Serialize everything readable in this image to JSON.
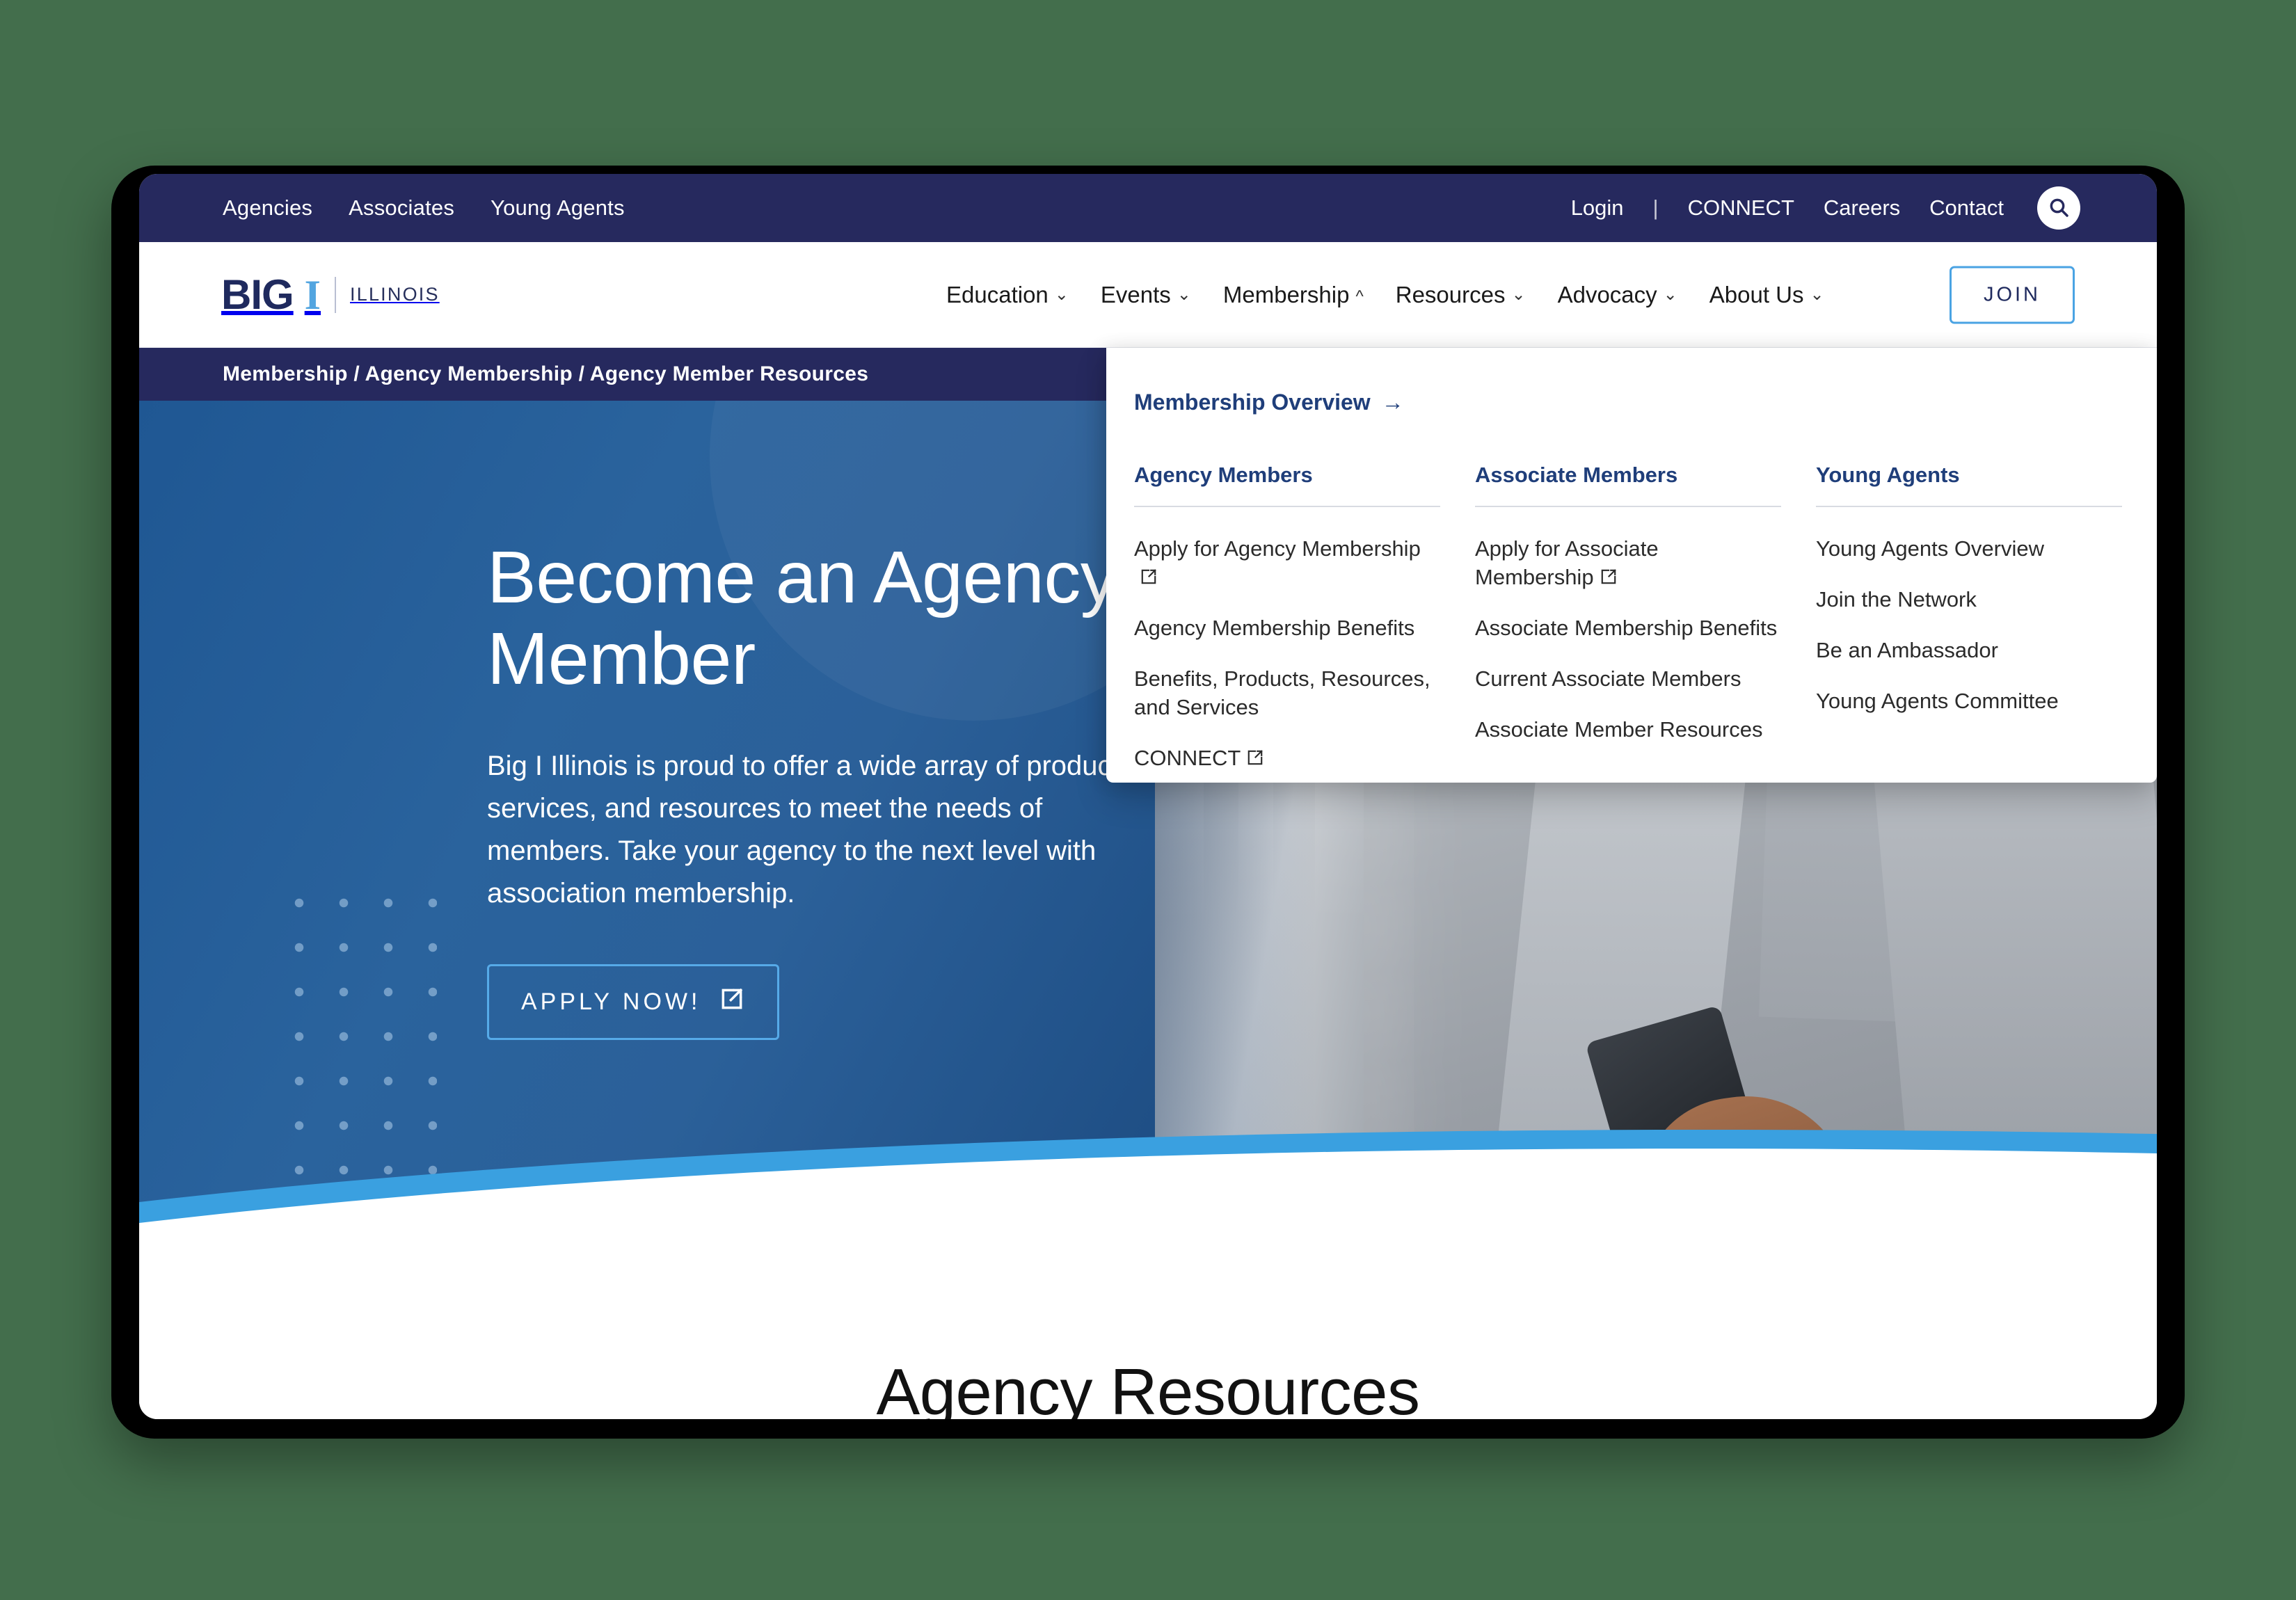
{
  "colors": {
    "page_background": "#436e4c",
    "navy": "#26295e",
    "brand_blue": "#4aa3e3",
    "hero_blue": "#2a639d",
    "link_navy": "#1f3e7a"
  },
  "utility_bar": {
    "left_links": [
      "Agencies",
      "Associates",
      "Young Agents"
    ],
    "right_links": [
      "Login",
      "CONNECT",
      "Careers",
      "Contact"
    ],
    "separator": "|",
    "search_icon": "search-icon"
  },
  "logo": {
    "big": "BIG",
    "mark": "I",
    "state": "ILLINOIS"
  },
  "main_nav": {
    "items": [
      {
        "label": "Education",
        "expanded": false
      },
      {
        "label": "Events",
        "expanded": false
      },
      {
        "label": "Membership",
        "expanded": true
      },
      {
        "label": "Resources",
        "expanded": false
      },
      {
        "label": "Advocacy",
        "expanded": false
      },
      {
        "label": "About Us",
        "expanded": false
      }
    ],
    "chevron_down": "⌄",
    "chevron_up": "^",
    "join_label": "JOIN"
  },
  "breadcrumb": {
    "text": "Membership / Agency Membership / Agency Member Resources"
  },
  "mega_menu": {
    "overview_label": "Membership Overview",
    "overview_arrow": "→",
    "columns": [
      {
        "heading": "Agency Members",
        "links": [
          {
            "label": "Apply for Agency Membership",
            "external": true
          },
          {
            "label": "Agency Membership Benefits",
            "external": false
          },
          {
            "label": "Benefits, Products, Resources, and Services",
            "external": false
          },
          {
            "label": "CONNECT",
            "external": true
          }
        ]
      },
      {
        "heading": "Associate Members",
        "links": [
          {
            "label": "Apply for Associate Membership",
            "external": true
          },
          {
            "label": "Associate Membership Benefits",
            "external": false
          },
          {
            "label": "Current Associate Members",
            "external": false
          },
          {
            "label": "Associate Member Resources",
            "external": false
          }
        ]
      },
      {
        "heading": "Young Agents",
        "links": [
          {
            "label": "Young Agents Overview",
            "external": false
          },
          {
            "label": "Join the Network",
            "external": false
          },
          {
            "label": "Be an Ambassador",
            "external": false
          },
          {
            "label": "Young Agents Committee",
            "external": false
          }
        ]
      }
    ]
  },
  "hero": {
    "title": "Become an Agency Member",
    "body": "Big I Illinois is proud to offer a wide array of products, services, and resources to meet the needs of members. Take your agency to the next level with association membership.",
    "cta_label": "APPLY NOW!",
    "cta_icon": "external-link-icon",
    "photo_alt": "business person in grey blazer holding a phone"
  },
  "resources_section": {
    "title": "Agency Resources"
  }
}
